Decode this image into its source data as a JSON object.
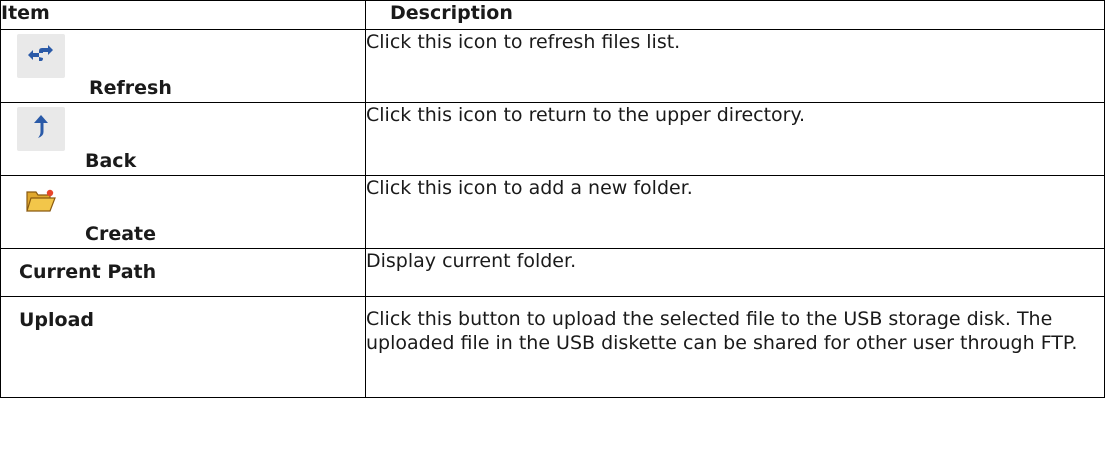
{
  "table": {
    "headers": {
      "item": "Item",
      "description": "Description"
    },
    "rows": [
      {
        "item": "Refresh",
        "icon": "refresh-icon",
        "description": "Click this icon to refresh files list."
      },
      {
        "item": "Back",
        "icon": "back-arrow-icon",
        "description": "Click this icon to return to the upper directory."
      },
      {
        "item": "Create",
        "icon": "folder-icon",
        "description": "Click this icon to add a new folder."
      },
      {
        "item": "Current Path",
        "description": "Display current folder."
      },
      {
        "item": "Upload",
        "description": "Click this button to upload the selected file to the USB storage disk. The uploaded file in the USB diskette can be shared for other user through FTP."
      }
    ]
  },
  "colors": {
    "icon_background": "#e9e9e9",
    "arrow_blue": "#2a5aa8",
    "folder_yellow": "#f2c64a"
  }
}
